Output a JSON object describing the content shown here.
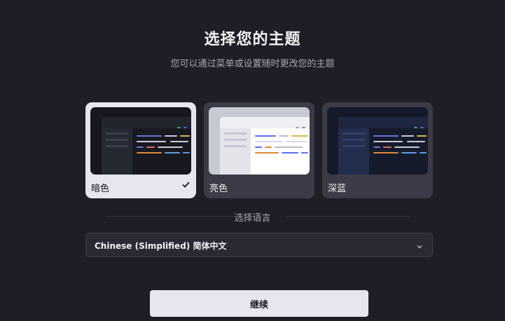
{
  "header": {
    "title": "选择您的主题",
    "subtitle": "您可以通过菜单或设置随时更改您的主题"
  },
  "themes": [
    {
      "label": "暗色",
      "selected": true,
      "check_icon": "checkmark-icon"
    },
    {
      "label": "亮色",
      "selected": false
    },
    {
      "label": "深蓝",
      "selected": false
    }
  ],
  "language": {
    "section_label": "选择语言",
    "selected_value": "Chinese (Simplified) 简体中文",
    "dropdown_icon": "chevron-down-icon"
  },
  "actions": {
    "continue_label": "继续"
  },
  "colors": {
    "background": "#1e1e27",
    "selected_card": "#e6e6ee",
    "unselected_card": "#3b3b47",
    "accent_green": "#3dba7a",
    "accent_blue": "#5b6ff0"
  }
}
